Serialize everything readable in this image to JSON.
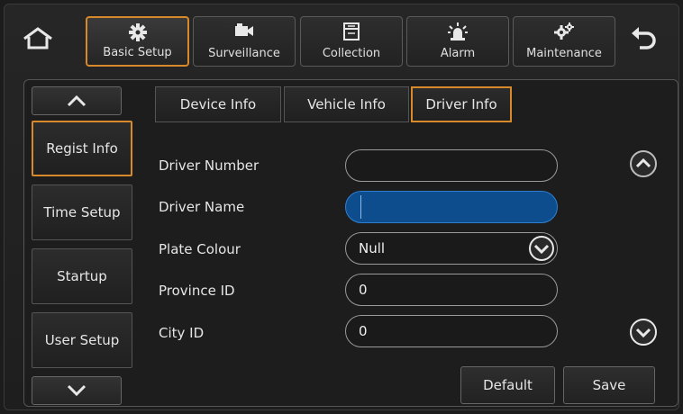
{
  "top_tabs": [
    {
      "label": "Basic Setup",
      "icon": "gear-icon",
      "active": true
    },
    {
      "label": "Surveillance",
      "icon": "camera-icon",
      "active": false
    },
    {
      "label": "Collection",
      "icon": "archive-icon",
      "active": false
    },
    {
      "label": "Alarm",
      "icon": "alarm-light-icon",
      "active": false
    },
    {
      "label": "Maintenance",
      "icon": "gears-icon",
      "active": false
    }
  ],
  "sidebar": {
    "items": [
      "Regist Info",
      "Time Setup",
      "Startup",
      "User Setup"
    ],
    "active_index": 0
  },
  "sub_tabs": [
    "Device Info",
    "Vehicle Info",
    "Driver Info"
  ],
  "form": {
    "driver_number_label": "Driver Number",
    "driver_number_value": "",
    "driver_name_label": "Driver Name",
    "driver_name_value": "",
    "plate_colour_label": "Plate Colour",
    "plate_colour_value": "Null",
    "province_id_label": "Province ID",
    "province_id_value": "0",
    "city_id_label": "City ID",
    "city_id_value": "0"
  },
  "actions": {
    "default_label": "Default",
    "save_label": "Save"
  },
  "colors": {
    "accent": "#d8892a",
    "focus_field": "#0d4d8e"
  }
}
